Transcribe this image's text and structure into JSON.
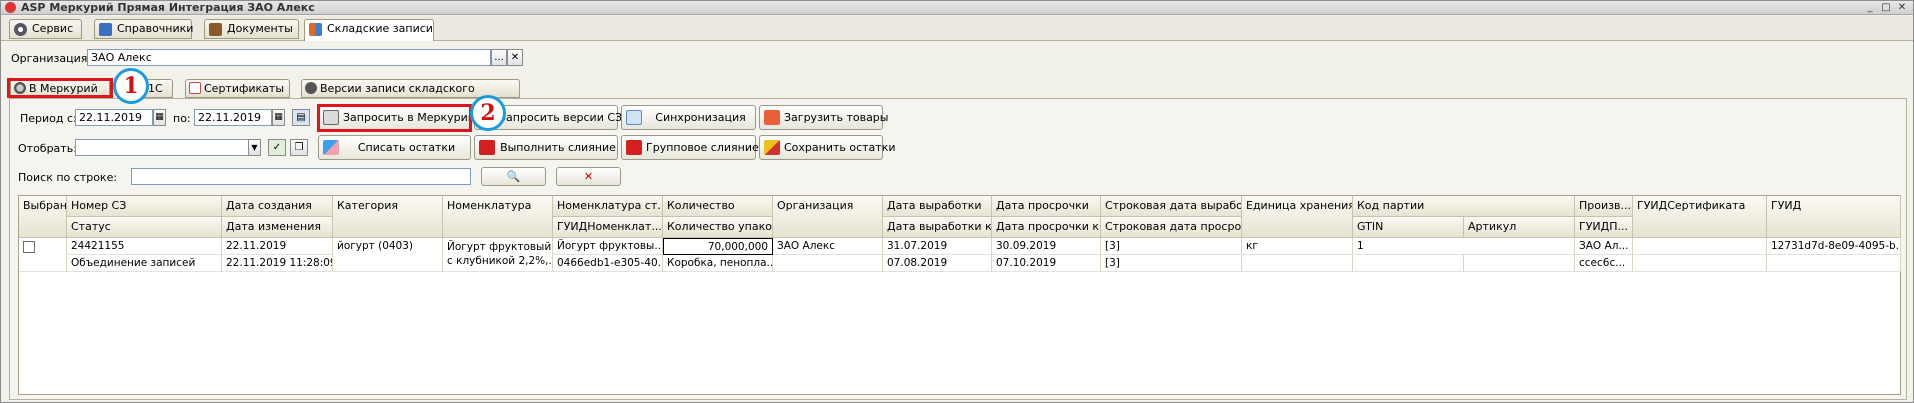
{
  "window": {
    "title": "ASP Меркурий Прямая Интеграция ЗАО Алекс",
    "min": "_",
    "max": "□",
    "close": "✕"
  },
  "top_tabs": [
    {
      "label": "Сервис",
      "icon": "gear-icon"
    },
    {
      "label": "Справочники",
      "icon": "book-icon"
    },
    {
      "label": "Документы",
      "icon": "briefcase-icon"
    },
    {
      "label": "Складские записи",
      "icon": "boxes-icon"
    }
  ],
  "org": {
    "label": "Организация:",
    "value": "ЗАО Алекс",
    "dots": "...",
    "clear": "✕"
  },
  "sub_tabs": [
    {
      "label": "В Меркурий"
    },
    {
      "label": "1С"
    },
    {
      "label": "Сертификаты"
    },
    {
      "label": "Версии записи складского журнала"
    }
  ],
  "period": {
    "label_from": "Период с:",
    "from": "22.11.2019",
    "label_to": "по:",
    "to": "22.11.2019"
  },
  "select": {
    "label": "Отобрать:"
  },
  "search": {
    "label": "Поиск по строке:"
  },
  "buttons": {
    "request": "Запросить в Меркурий",
    "request_versions": "Запросить версии СЗ",
    "sync": "Синхронизация",
    "load": "Загрузить товары",
    "writeoff": "Списать остатки",
    "merge": "Выполнить слияние",
    "group_merge": "Групповое слияние",
    "save_rest": "Сохранить остатки"
  },
  "badges": [
    "1",
    "2"
  ],
  "grid": {
    "headers1": [
      "Выбран",
      "Номер СЗ",
      "Дата создания",
      "Категория",
      "Номенклатура",
      "Номенклатура ст...",
      "Количество",
      "Организация",
      "Дата выработки",
      "Дата просрочки",
      "Строковая дата вырабо...",
      "Единица хранения",
      "Код партии",
      "Произв...",
      "ГУИДСертификата",
      "ГУИД"
    ],
    "headers2": [
      "Статус",
      "Дата изменения",
      "ГУИДНоменклат...",
      "Количество упако...",
      "Дата выработки к...",
      "Дата просрочки к...",
      "Строковая дата просроч...",
      "GTIN",
      "Артикул",
      "ГУИДП..."
    ],
    "row1": [
      "24421155",
      "22.11.2019",
      "йогурт (0403)",
      "Йогурт фруктовый",
      "Йогурт фруктовы...",
      "70,000,000",
      "ЗАО Алекс",
      "31.07.2019",
      "30.09.2019",
      "[3]",
      "кг",
      "1",
      "ЗАО Ал...",
      "12731d7d-8e09-4095-b..."
    ],
    "row1b": "с клубникой 2,2%,...",
    "row2": [
      "Объединение записей",
      "22.11.2019 11:28:09",
      "0466edb1-e305-40...",
      "Коробка, пенопла...",
      "07.08.2019",
      "07.10.2019",
      "[3]",
      "ccec6c..."
    ]
  }
}
